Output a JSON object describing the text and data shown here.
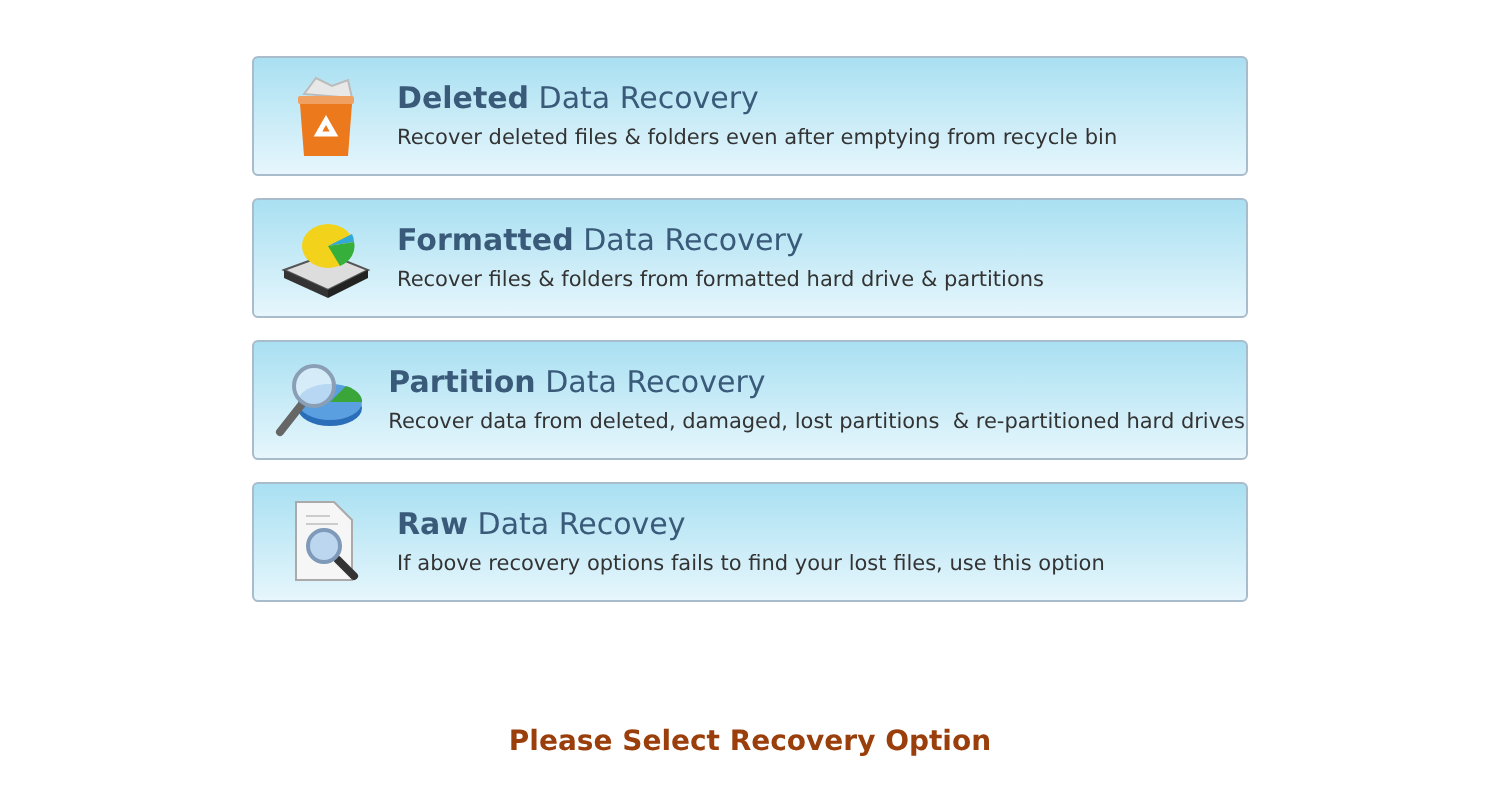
{
  "options": [
    {
      "kind": "trash",
      "title": "**Deleted** Data Recovery",
      "description": "Recover deleted files & folders even after emptying from recycle bin"
    },
    {
      "kind": "disk",
      "title": "**Formatted** Data Recovery",
      "description": "Recover files & folders from formatted hard drive & partitions"
    },
    {
      "kind": "partition",
      "title": "**Partition** Data Recovery",
      "description": "Recover data from deleted, damaged, lost partitions  & re-partitioned hard drives"
    },
    {
      "kind": "raw",
      "title": "**Raw** Data Recovey",
      "description": "If above recovery options fails to find your lost files, use this option"
    }
  ],
  "prompt": "Please Select Recovery Option"
}
